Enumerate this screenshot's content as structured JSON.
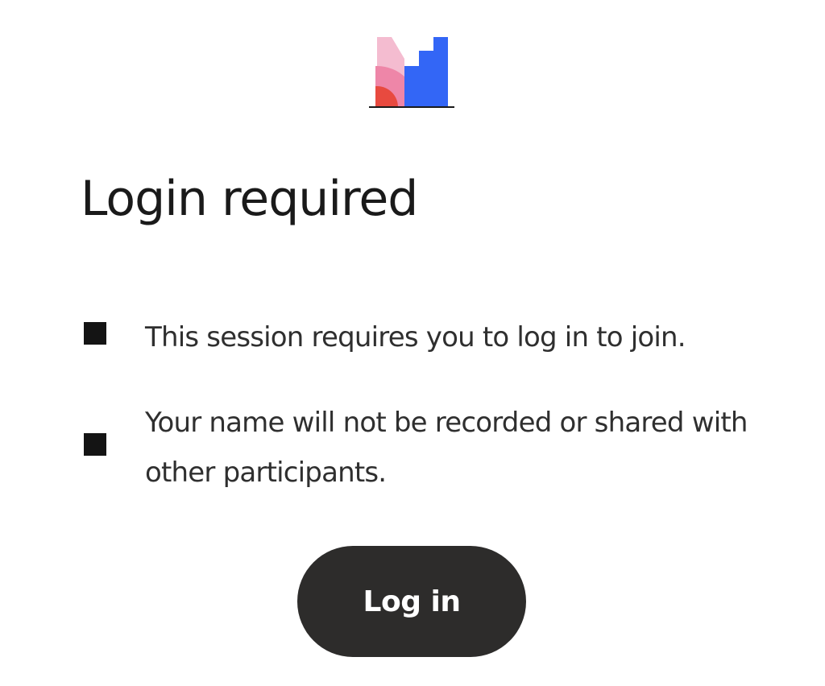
{
  "brand": {
    "logo_icon": "mentimeter-logo-icon",
    "colors": {
      "light_pink": "#f4bcd0",
      "pink": "#ee86a8",
      "red": "#e84a3f",
      "blue": "#3366f6",
      "baseline": "#1a1a1a"
    }
  },
  "dialog": {
    "title": "Login required",
    "notices": [
      {
        "text": "This session requires you to log in to join.",
        "bullet_icon": "square-bullet-icon"
      },
      {
        "text": "Your name will not be recorded or shared with other participants.",
        "bullet_icon": "square-bullet-icon"
      }
    ],
    "login_button_label": "Log in"
  },
  "theme": {
    "text_color": "#1a1a1a",
    "body_text_color": "#2f2f2f",
    "button_background": "#2d2c2b",
    "button_text_color": "#ffffff"
  }
}
